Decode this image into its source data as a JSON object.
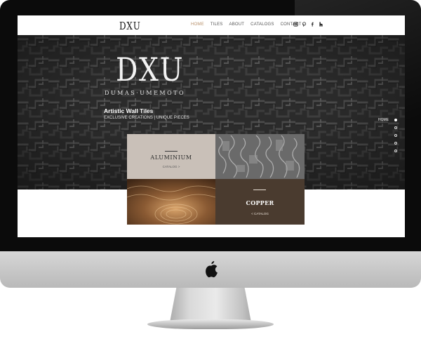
{
  "nav": {
    "logo": "DXU",
    "links": [
      "HOME",
      "TILES",
      "ABOUT",
      "CATALOGS",
      "CONTACT"
    ],
    "active": "HOME",
    "social_icons": [
      "instagram-icon",
      "pinterest-icon",
      "facebook-icon",
      "houzz-icon"
    ]
  },
  "hero": {
    "logo": "DXU",
    "brand": "DUMAS·UMEMOTO",
    "title": "Artistic Wall Tiles",
    "tagline": "EXCLUSIVE CREATIONS | UNIQUE PIECES"
  },
  "slider": {
    "current_label": "HOME",
    "dot_count": 4,
    "active_index": 0
  },
  "categories": {
    "aluminium": {
      "title": "ALUMINIUM",
      "link": "CATALOG >"
    },
    "copper": {
      "title": "COPPER",
      "link": "< CATALOG"
    }
  },
  "colors": {
    "accent": "#b7906a",
    "hero_bg": "#2d2d2d",
    "aluminium_tile": "#c9c0b8",
    "copper_tile": "#4a3b2f"
  }
}
